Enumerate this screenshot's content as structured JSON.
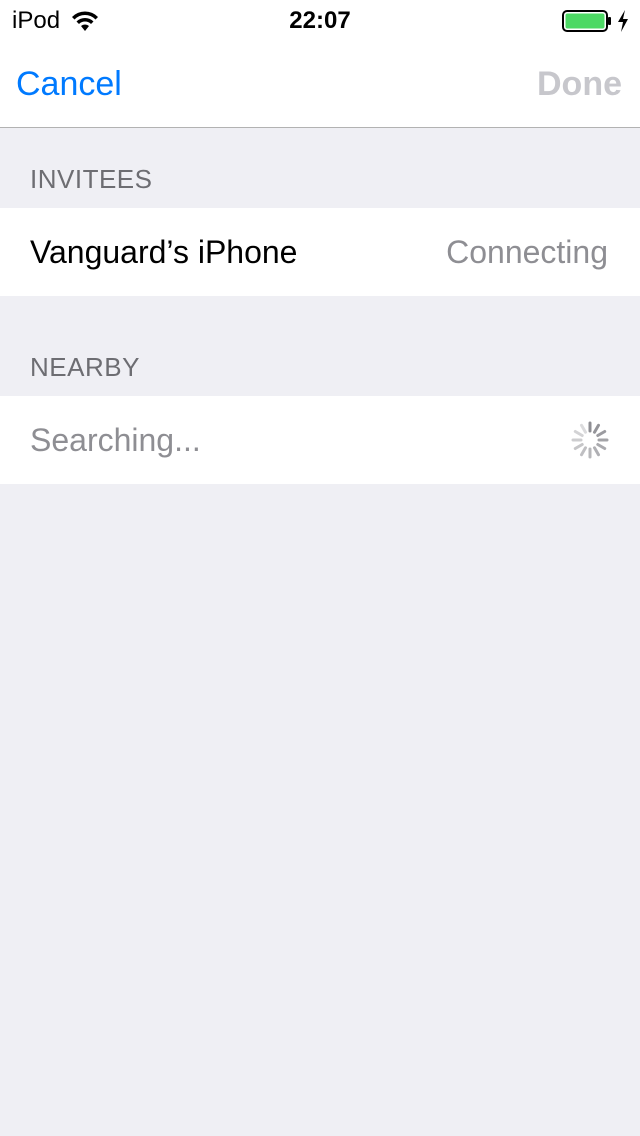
{
  "status_bar": {
    "device": "iPod",
    "time": "22:07",
    "wifi_icon": "wifi-icon",
    "battery_icon": "battery-charging-icon",
    "battery_level": 1.0,
    "battery_color": "#4cd964"
  },
  "nav": {
    "cancel_label": "Cancel",
    "done_label": "Done",
    "accent_color": "#007aff",
    "disabled_color": "#c7c7cc"
  },
  "invitees": {
    "header": "INVITEES",
    "items": [
      {
        "name": "Vanguard’s iPhone",
        "status": "Connecting"
      }
    ]
  },
  "nearby": {
    "header": "NEARBY",
    "placeholder": "Searching...",
    "spinner_icon": "activity-spinner-icon"
  }
}
